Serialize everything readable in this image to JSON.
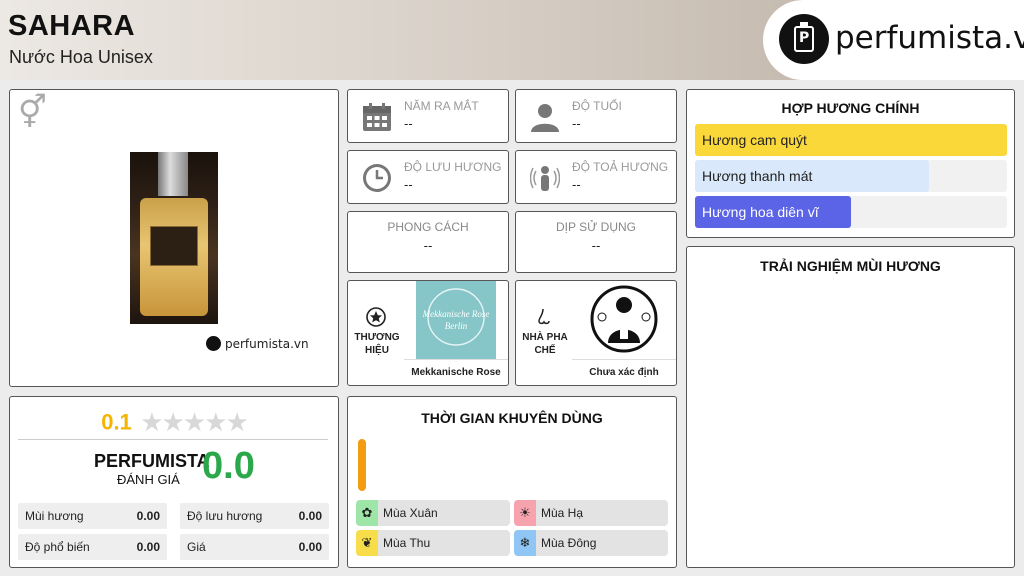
{
  "header": {
    "title": "SAHARA",
    "subtitle": "Nước Hoa Unisex",
    "logo_text": "perfumista.vn"
  },
  "product_card": {
    "gender_icon": "unisex-gender-icon",
    "watermark": "perfumista.vn"
  },
  "info": {
    "year": {
      "label": "NĂM RA MẮT",
      "value": "--",
      "icon": "calendar-icon"
    },
    "age": {
      "label": "ĐỘ TUỔI",
      "value": "--",
      "icon": "person-icon"
    },
    "longevity": {
      "label": "ĐỘ LƯU HƯƠNG",
      "value": "--",
      "icon": "clock-icon"
    },
    "sillage": {
      "label": "ĐỘ TOẢ HƯƠNG",
      "value": "--",
      "icon": "radiating-person-icon"
    },
    "style": {
      "label": "PHONG CÁCH",
      "value": "--"
    },
    "occasion": {
      "label": "DỊP SỬ DỤNG",
      "value": "--"
    }
  },
  "brand": {
    "label": "THƯƠNG HIỆU",
    "name": "Mekkanische Rose",
    "logo_text_1": "Mekkanische Rose",
    "logo_text_2": "Berlin",
    "icon": "star-badge-icon"
  },
  "perfumer": {
    "label": "NHÀ PHA CHẾ",
    "name": "Chưa xác định",
    "icon": "nose-icon"
  },
  "accords": {
    "title": "HỢP HƯƠNG CHÍNH",
    "items": [
      {
        "name": "Hương cam quýt",
        "level": 1.0,
        "color": "#fbd83a",
        "text_color": "#222222"
      },
      {
        "name": "Hương thanh mát",
        "level": 0.75,
        "color": "#d9e8fa",
        "text_color": "#222222"
      },
      {
        "name": "Hương hoa diên vĩ",
        "level": 0.5,
        "color": "#5b63e6",
        "text_color": "#ffffff"
      }
    ]
  },
  "experience": {
    "title": "TRẢI NGHIỆM MÙI HƯƠNG"
  },
  "rating": {
    "user_score": "0.1",
    "stars_max": 5,
    "brand": "PERFUMISTA",
    "brand_sub": "ĐÁNH GIÁ",
    "score": "0.0",
    "metrics": [
      {
        "label": "Mùi hương",
        "value": "0.00"
      },
      {
        "label": "Độ lưu hương",
        "value": "0.00"
      },
      {
        "label": "Độ phổ biến",
        "value": "0.00"
      },
      {
        "label": "Giá",
        "value": "0.00"
      }
    ]
  },
  "time": {
    "title": "THỜI GIAN KHUYÊN DÙNG",
    "seasons": [
      {
        "label": "Mùa Xuân",
        "icon": "flower-icon",
        "color": "#9ee6a8"
      },
      {
        "label": "Mùa Hạ",
        "icon": "sun-icon",
        "color": "#f7a3ad"
      },
      {
        "label": "Mùa Thu",
        "icon": "leaf-icon",
        "color": "#f7dd4a"
      },
      {
        "label": "Mùa Đông",
        "icon": "snowflake-icon",
        "color": "#8fc6f5"
      }
    ]
  }
}
